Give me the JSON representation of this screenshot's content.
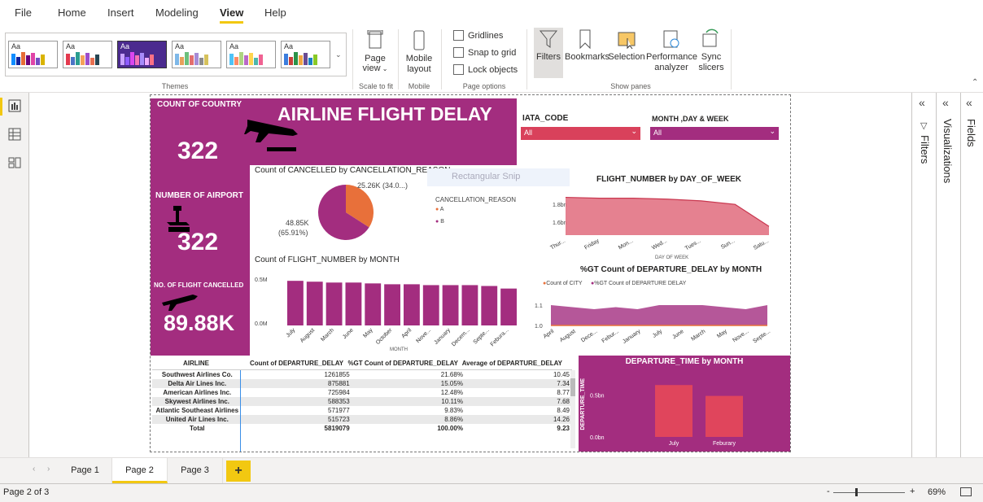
{
  "menu": {
    "items": [
      "File",
      "Home",
      "Insert",
      "Modeling",
      "View",
      "Help"
    ],
    "active": "View"
  },
  "ribbon": {
    "themes_label": "Themes",
    "theme_aa": "Aa",
    "page_view": "Page view",
    "scale_label": "Scale to fit",
    "mobile_layout": "Mobile layout",
    "mobile_label": "Mobile",
    "gridlines": "Gridlines",
    "snap": "Snap to grid",
    "lock": "Lock objects",
    "page_options_label": "Page options",
    "filters": "Filters",
    "bookmarks": "Bookmarks",
    "selection": "Selection",
    "performance": "Performance analyzer",
    "sync": "Sync slicers",
    "show_panes_label": "Show panes"
  },
  "report": {
    "title": "AIRLINE FLIGHT DELAY",
    "country_label": "COUNT OF COUNTRY",
    "country_value": "322",
    "airport_label": "NUMBER OF AIRPORT",
    "airport_value": "322",
    "cancelled_label": "NO. OF FLIGHT CANCELLED",
    "cancelled_value": "89.88K",
    "slicer1_label": "IATA_CODE",
    "slicer1_value": "All",
    "slicer2_label": "MONTH ,DAY & WEEK",
    "slicer2_value": "All",
    "snip_text": "Rectangular Snip",
    "pie_title": "Count of CANCELLED by CANCELLATION_REASON",
    "pie_label_a": "25.26K (34.0...)",
    "pie_label_b1": "48.85K",
    "pie_label_b2": "(65.91%)",
    "pie_legend_title": "CANCELLATION_REASON",
    "pie_legend_a": "A",
    "pie_legend_b": "B",
    "bar_title": "Count of FLIGHT_NUMBER by MONTH",
    "bar_xlabel": "MONTH",
    "area_title": "FLIGHT_NUMBER by DAY_OF_WEEK",
    "area_xlabel": "DAY OF WEEK",
    "dep_title": "%GT Count of DEPARTURE_DELAY by MONTH",
    "dep_legend_a": "Count of CITY",
    "dep_legend_b": "%GT Count of DEPARTURE DELAY",
    "dt_title": "DEPARTURE_TIME by MONTH",
    "dt_ylabel": "DEPARTURE_TIME"
  },
  "table": {
    "headers": [
      "AIRLINE",
      "Count of DEPARTURE_DELAY",
      "%GT Count of DEPARTURE_DELAY",
      "Average of DEPARTURE_DELAY"
    ],
    "rows": [
      [
        "Southwest Airlines Co.",
        "1261855",
        "21.68%",
        "10.45"
      ],
      [
        "Delta Air Lines Inc.",
        "875881",
        "15.05%",
        "7.34"
      ],
      [
        "American Airlines Inc.",
        "725984",
        "12.48%",
        "8.77"
      ],
      [
        "Skywest Airlines Inc.",
        "588353",
        "10.11%",
        "7.68"
      ],
      [
        "Atlantic Southeast Airlines",
        "571977",
        "9.83%",
        "8.49"
      ],
      [
        "United Air Lines Inc.",
        "515723",
        "8.86%",
        "14.26"
      ]
    ],
    "total": [
      "Total",
      "5819079",
      "100.00%",
      "9.23"
    ]
  },
  "chart_data": [
    {
      "type": "pie",
      "title": "Count of CANCELLED by CANCELLATION_REASON",
      "legend_title": "CANCELLATION_REASON",
      "categories": [
        "A",
        "B"
      ],
      "values": [
        25260,
        48850
      ],
      "labels": [
        "25.26K (34.0...)",
        "48.85K (65.91%)"
      ],
      "colors": [
        "#e8703a",
        "#a32d7f"
      ]
    },
    {
      "type": "bar",
      "title": "Count of FLIGHT_NUMBER by MONTH",
      "xlabel": "MONTH",
      "categories": [
        "July",
        "August",
        "March",
        "June",
        "May",
        "October",
        "April",
        "Nove...",
        "January",
        "Decem...",
        "Septe...",
        "Febura..."
      ],
      "values": [
        0.52,
        0.51,
        0.5,
        0.5,
        0.49,
        0.48,
        0.48,
        0.47,
        0.47,
        0.47,
        0.46,
        0.43
      ],
      "yticks": [
        "0.5M",
        "0.0M"
      ],
      "ylim": [
        0,
        0.55
      ],
      "unit": "M",
      "color": "#a32d7f"
    },
    {
      "type": "area",
      "title": "FLIGHT_NUMBER by DAY_OF_WEEK",
      "xlabel": "DAY OF WEEK",
      "categories": [
        "Thur...",
        "Friday",
        "Mon...",
        "Wed...",
        "Tues...",
        "Sun...",
        "Satu..."
      ],
      "values": [
        1.88,
        1.87,
        1.87,
        1.86,
        1.84,
        1.8,
        1.55
      ],
      "yticks": [
        "1.8bn",
        "1.6bn"
      ],
      "ylim": [
        1.45,
        1.95
      ],
      "unit": "bn",
      "color": "#e06b7d"
    },
    {
      "type": "area",
      "title": "%GT Count of DEPARTURE_DELAY by MONTH",
      "categories": [
        "April",
        "August",
        "Dece...",
        "Febur...",
        "January",
        "July",
        "June",
        "March",
        "May",
        "Nove...",
        "Septe..."
      ],
      "series": [
        {
          "name": "Count of CITY",
          "values": [
            1.0,
            1.0,
            1.0,
            1.0,
            1.0,
            1.0,
            1.0,
            1.0,
            1.0,
            1.0,
            1.0
          ],
          "color": "#e8703a"
        },
        {
          "name": "%GT Count of DEPARTURE DELAY",
          "values": [
            1.1,
            1.09,
            1.08,
            1.09,
            1.08,
            1.1,
            1.1,
            1.1,
            1.09,
            1.08,
            1.1
          ],
          "color": "#a32d7f"
        }
      ],
      "yticks": [
        "1.1",
        "1.0"
      ],
      "ylim": [
        0.98,
        1.14
      ]
    },
    {
      "type": "bar",
      "title": "DEPARTURE_TIME by MONTH",
      "ylabel": "DEPARTURE_TIME",
      "categories": [
        "July",
        "Feburary"
      ],
      "values": [
        0.62,
        0.49
      ],
      "yticks": [
        "0.5bn",
        "0.0bn"
      ],
      "ylim": [
        0,
        0.7
      ],
      "unit": "bn",
      "color": "#e0455c"
    }
  ],
  "panes": {
    "filters": "Filters",
    "visualizations": "Visualizations",
    "fields": "Fields"
  },
  "tabs": {
    "items": [
      "Page 1",
      "Page 2",
      "Page 3"
    ],
    "active": "Page 2",
    "add": "+"
  },
  "status": {
    "page": "Page 2 of 3",
    "zoom": "69%",
    "minus": "-",
    "plus": "+"
  },
  "colors": {
    "brand": "#a32d7f",
    "accent": "#f2c811",
    "slicer": "#d9415b",
    "orange": "#e8703a"
  }
}
